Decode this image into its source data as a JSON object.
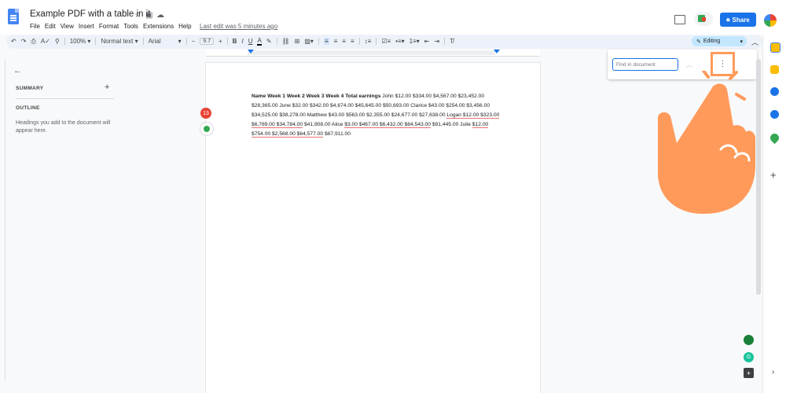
{
  "header": {
    "doc_title": "Example PDF with a table in it",
    "menu": [
      "File",
      "Edit",
      "View",
      "Insert",
      "Format",
      "Tools",
      "Extensions",
      "Help"
    ],
    "last_edit": "Last edit was 5 minutes ago",
    "share_label": "Share"
  },
  "toolbar": {
    "zoom": "100%",
    "style": "Normal text",
    "font": "Arial",
    "font_size": "9.7",
    "editing_label": "Editing"
  },
  "outline": {
    "summary_label": "SUMMARY",
    "outline_label": "OUTLINE",
    "hint": "Headings you add to the document will appear here."
  },
  "document": {
    "bold_header": "Name Week 1 Week 2 Week 3 Week 4 Total earnings",
    "body_1": " John $12.00 $334.00 $4,567.00 $23,452.00 $28,365.00 June $32.00 $342.00 $4,674.00 $45,645.00 $50,693.00 Clarice $43.00 $254.00 $3,456.00 $34,525.00 $38,278.00 Matthew $43.00 $563.00 $2,355.00 $24,677.00 $27,638.00 ",
    "logan_line": "Logan $12.00 $323.00 $6,789.00 $34,784.00",
    "body_2": " $41,908.00 Alice ",
    "alice_line": "$3.00 $467.00 $6,432.00 $84,543.00",
    "body_3": " $91,445.00 Julie ",
    "julie_line": "$12.00 $754.00 $2,568.00 $64,577.00",
    "body_4": " $67,911.00"
  },
  "find": {
    "placeholder": "Find in document"
  },
  "badge_count": "13",
  "colors": {
    "share_blue": "#1a73e8",
    "highlight_orange": "#ff9a5a",
    "badge_red": "#e94235"
  }
}
